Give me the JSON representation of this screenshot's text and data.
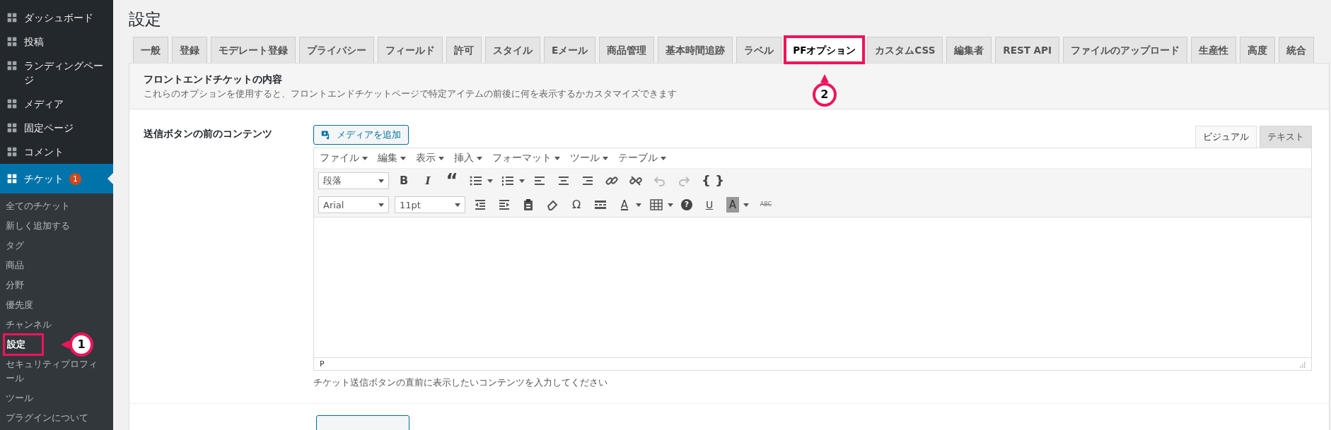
{
  "sidebar": {
    "items": [
      {
        "label": "ダッシュボード",
        "selected": false
      },
      {
        "label": "投稿",
        "selected": false
      },
      {
        "label": "ランディングページ",
        "selected": false
      },
      {
        "label": "メディア",
        "selected": false
      },
      {
        "label": "固定ページ",
        "selected": false
      },
      {
        "label": "コメント",
        "selected": false
      },
      {
        "label": "チケット",
        "selected": true,
        "badge": "1"
      }
    ],
    "submenu": [
      {
        "label": "全てのチケット",
        "selected": false
      },
      {
        "label": "新しく追加する",
        "selected": false
      },
      {
        "label": "タグ",
        "selected": false
      },
      {
        "label": "商品",
        "selected": false
      },
      {
        "label": "分野",
        "selected": false
      },
      {
        "label": "優先度",
        "selected": false
      },
      {
        "label": "チャンネル",
        "selected": false
      },
      {
        "label": "設定",
        "selected": true,
        "callout": "1"
      },
      {
        "label": "セキュリティプロフィール",
        "selected": false
      },
      {
        "label": "ツール",
        "selected": false
      },
      {
        "label": "プラグインについて",
        "selected": false
      }
    ]
  },
  "page_title": "設定",
  "tabs": [
    {
      "label": "一般",
      "selected": false
    },
    {
      "label": "登録",
      "selected": false
    },
    {
      "label": "モデレート登録",
      "selected": false
    },
    {
      "label": "プライバシー",
      "selected": false
    },
    {
      "label": "フィールド",
      "selected": false
    },
    {
      "label": "許可",
      "selected": false
    },
    {
      "label": "スタイル",
      "selected": false
    },
    {
      "label": "Eメール",
      "selected": false
    },
    {
      "label": "商品管理",
      "selected": false
    },
    {
      "label": "基本時間追跡",
      "selected": false
    },
    {
      "label": "ラベル",
      "selected": false
    },
    {
      "label": "PFオプション",
      "selected": true,
      "callout": "2"
    },
    {
      "label": "カスタムCSS",
      "selected": false
    },
    {
      "label": "編集者",
      "selected": false
    },
    {
      "label": "REST API",
      "selected": false
    },
    {
      "label": "ファイルのアップロード",
      "selected": false
    },
    {
      "label": "生産性",
      "selected": false
    },
    {
      "label": "高度",
      "selected": false
    },
    {
      "label": "統合",
      "selected": false
    }
  ],
  "section": {
    "title": "フロントエンドチケットの内容",
    "description": "これらのオプションを使用すると、フロントエンドチケットページで特定アイテムの前後に何を表示するかカスタマイズできます"
  },
  "field": {
    "label": "送信ボタンの前のコンテンツ",
    "add_media": "メディアを追加",
    "editor_tabs": [
      {
        "label": "ビジュアル",
        "selected": true
      },
      {
        "label": "テキスト",
        "selected": false
      }
    ],
    "menu": [
      "ファイル",
      "編集",
      "表示",
      "挿入",
      "フォーマット",
      "ツール",
      "テーブル"
    ],
    "format_select": "段落",
    "font_select": "Arial",
    "size_select": "11pt",
    "glyphs": {
      "bold": "B",
      "italic": "I",
      "quote": "“",
      "code": "{ }",
      "omega": "Ω",
      "help": "?",
      "underline": "U",
      "text_color": "A",
      "bg_color": "A",
      "strike": "ABC"
    },
    "undo": {
      "disabled": true
    },
    "redo": {
      "disabled": true
    },
    "status_path": "P",
    "help": "チケット送信ボタンの直前に表示したいコンテンツを入力してください"
  }
}
